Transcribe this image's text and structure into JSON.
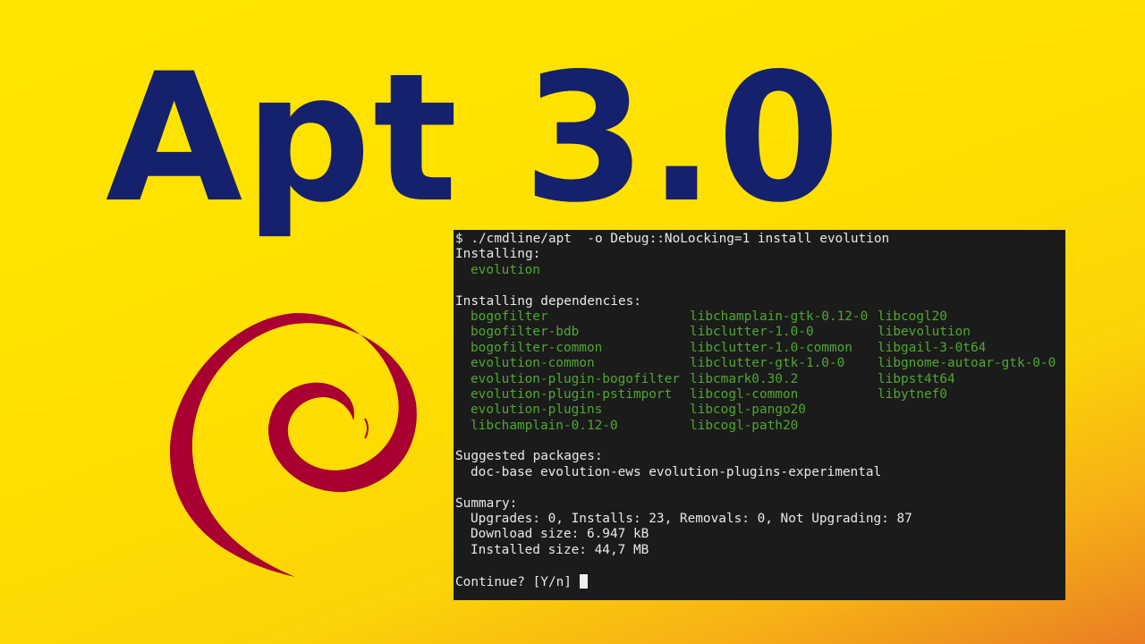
{
  "title": "Apt 3.0",
  "colors": {
    "title": "#16216e",
    "swirl": "#a80030",
    "terminal_bg": "#1b1b1b",
    "package_green": "#4fa82e",
    "terminal_text": "#e8e8e8"
  },
  "logo": {
    "icon": "debian-swirl-icon"
  },
  "terminal": {
    "command": "$ ./cmdline/apt  -o Debug::NoLocking=1 install evolution",
    "installing_header": "Installing:",
    "installing": [
      "evolution"
    ],
    "dependencies_header": "Installing dependencies:",
    "dependencies": [
      [
        "bogofilter",
        "libchamplain-gtk-0.12-0",
        "libcogl20"
      ],
      [
        "bogofilter-bdb",
        "libclutter-1.0-0",
        "libevolution"
      ],
      [
        "bogofilter-common",
        "libclutter-1.0-common",
        "libgail-3-0t64"
      ],
      [
        "evolution-common",
        "libclutter-gtk-1.0-0",
        "libgnome-autoar-gtk-0-0"
      ],
      [
        "evolution-plugin-bogofilter",
        "libcmark0.30.2",
        "libpst4t64"
      ],
      [
        "evolution-plugin-pstimport",
        "libcogl-common",
        "libytnef0"
      ],
      [
        "evolution-plugins",
        "libcogl-pango20",
        ""
      ],
      [
        "libchamplain-0.12-0",
        "libcogl-path20",
        ""
      ]
    ],
    "suggested_header": "Suggested packages:",
    "suggested": "doc-base evolution-ews evolution-plugins-experimental",
    "summary_header": "Summary:",
    "summary_counts": "Upgrades: 0, Installs: 23, Removals: 0, Not Upgrading: 87",
    "download_size": "Download size: 6.947 kB",
    "installed_size": "Installed size: 44,7 MB",
    "prompt": "Continue? [Y/n] "
  }
}
